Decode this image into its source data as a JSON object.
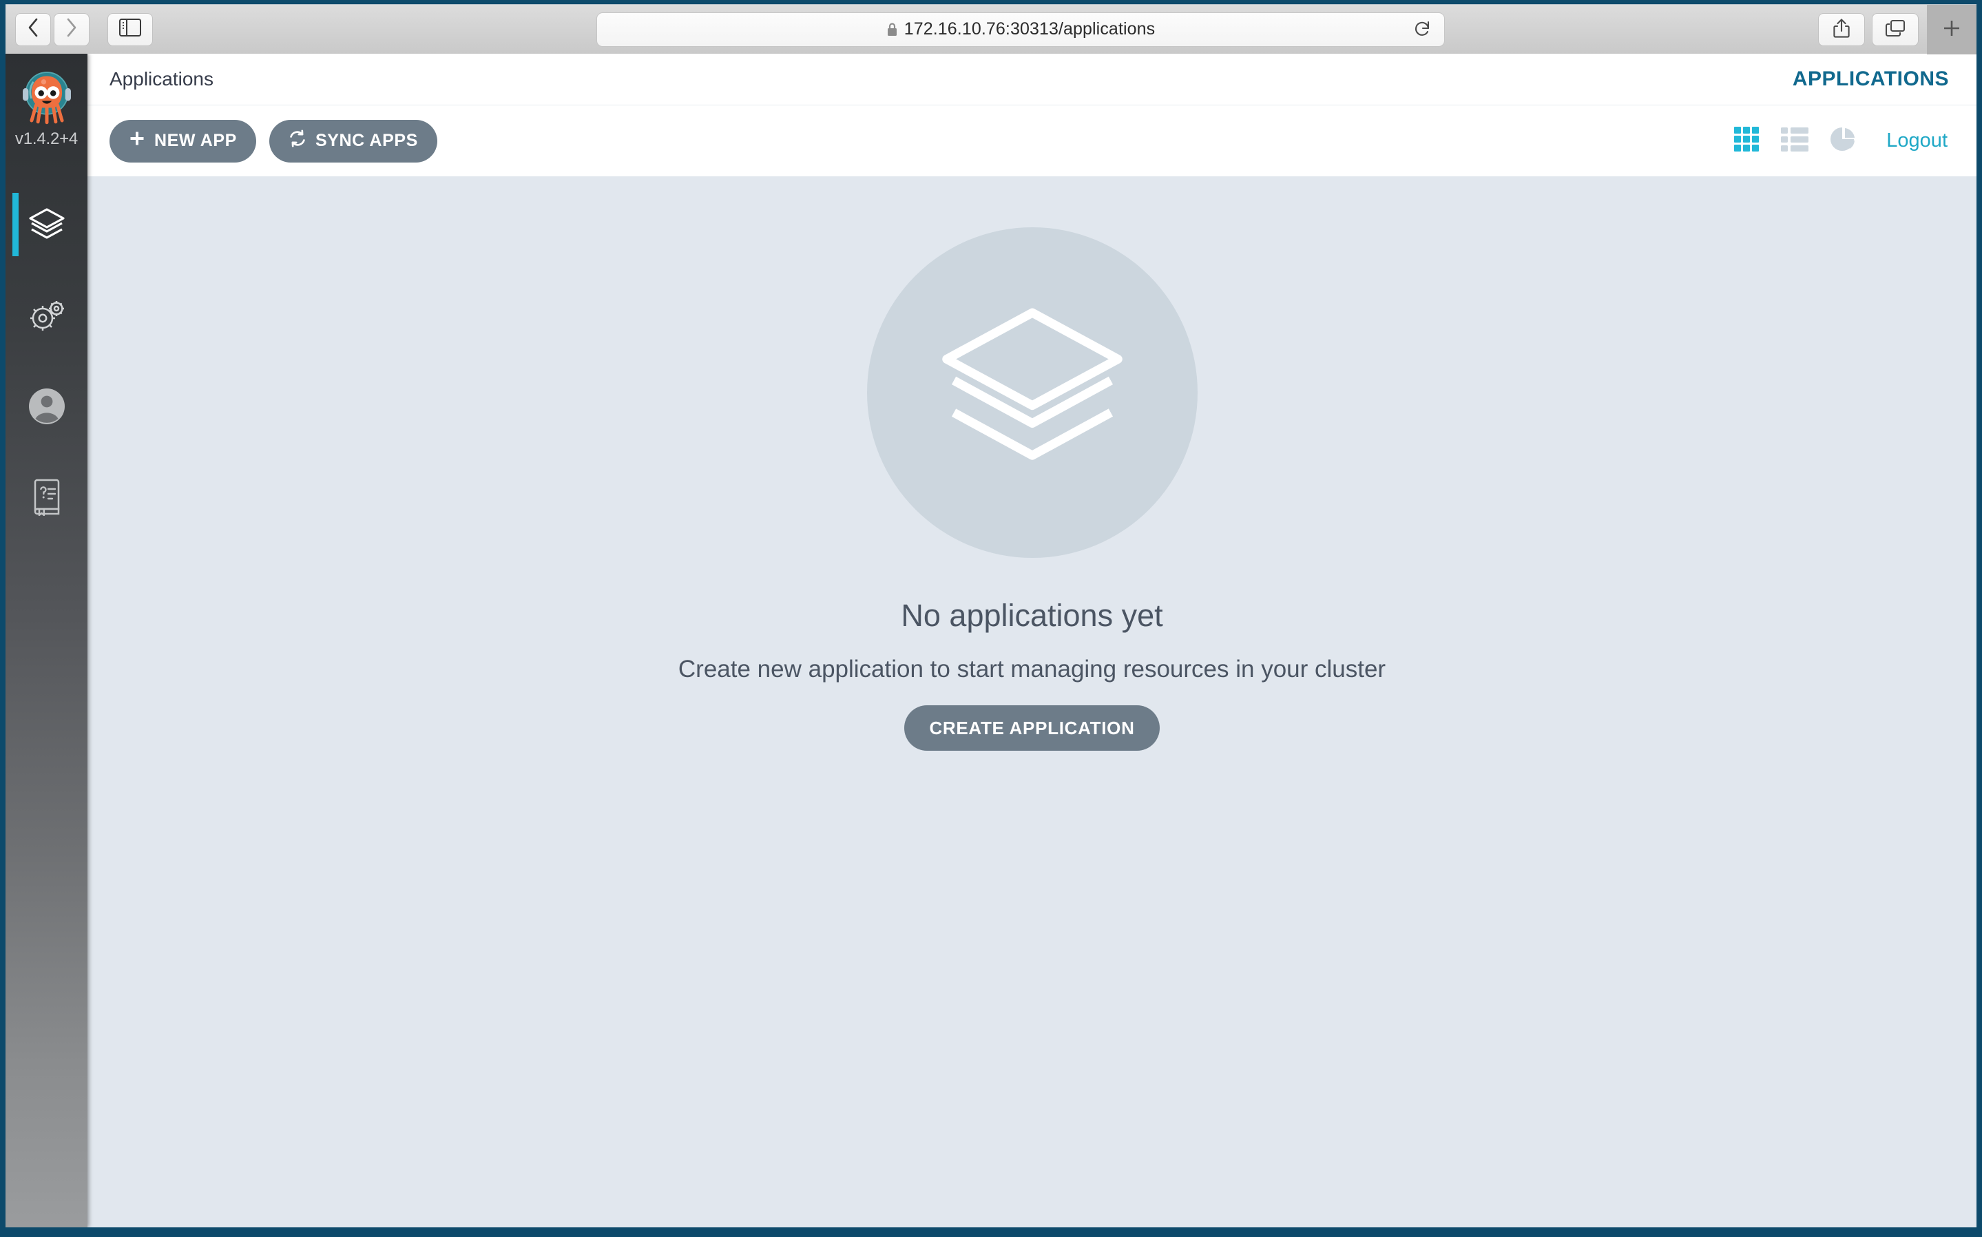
{
  "browser": {
    "back_icon": "chevron-left-icon",
    "forward_icon": "chevron-right-icon",
    "sidebar_toggle_icon": "sidebar-panel-icon",
    "url": "172.16.10.76:30313/applications",
    "lock_icon": "lock-icon",
    "reload_icon": "reload-icon",
    "share_icon": "share-icon",
    "tabs_icon": "tabs-overview-icon",
    "new_tab_label": "+"
  },
  "sidebar": {
    "brand_logo": "argo-octopus-logo",
    "version": "v1.4.2+4",
    "items": [
      {
        "name": "applications",
        "icon": "layers-icon",
        "active": true
      },
      {
        "name": "settings",
        "icon": "gears-icon",
        "active": false
      },
      {
        "name": "user-info",
        "icon": "user-circle-icon",
        "active": false
      },
      {
        "name": "documentation",
        "icon": "book-help-icon",
        "active": false
      }
    ]
  },
  "header": {
    "title": "Applications",
    "context_label": "APPLICATIONS"
  },
  "toolbar": {
    "new_app_label": "NEW APP",
    "new_app_icon": "plus-icon",
    "sync_apps_label": "SYNC APPS",
    "sync_apps_icon": "sync-refresh-icon",
    "views": [
      {
        "name": "tiles-view",
        "icon": "grid-tiles-icon",
        "active": true
      },
      {
        "name": "list-view",
        "icon": "list-rows-icon",
        "active": false
      },
      {
        "name": "summary-view",
        "icon": "pie-chart-icon",
        "active": false
      }
    ],
    "logout_label": "Logout"
  },
  "empty_state": {
    "illustration_icon": "layers-icon",
    "title": "No applications yet",
    "subtitle": "Create new application to start managing resources in your cluster",
    "cta_label": "CREATE APPLICATION"
  },
  "colors": {
    "accent_cyan": "#21b8d8",
    "header_teal": "#11698e",
    "button_slate": "#6d7c89",
    "content_bg": "#e1e7ee",
    "window_frame": "#0d4a6b"
  }
}
